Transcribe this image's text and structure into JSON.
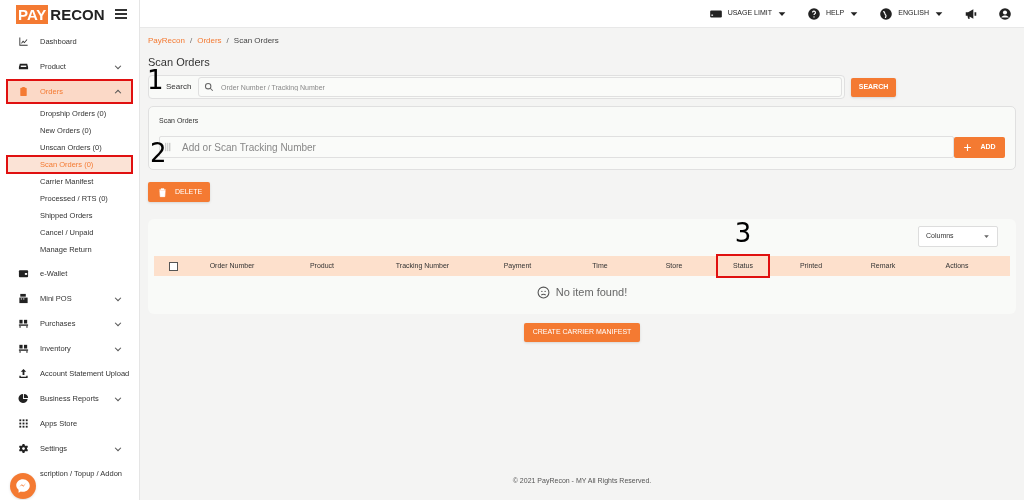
{
  "logo": {
    "left": "PAY",
    "right": "RECON"
  },
  "topbar": [
    {
      "kind": "usage",
      "label": "USAGE LIMIT",
      "dropdown": true
    },
    {
      "kind": "help",
      "label": "HELP",
      "dropdown": true
    },
    {
      "kind": "language",
      "label": "ENGLISH",
      "dropdown": true
    },
    {
      "kind": "announce"
    },
    {
      "kind": "account"
    }
  ],
  "sidebar": {
    "items": [
      {
        "label": "Dashboard",
        "selected": false,
        "highlighted": false
      },
      {
        "label": "Product",
        "selected": false,
        "highlighted": false,
        "expanded": false
      },
      {
        "label": "Orders",
        "selected": true,
        "highlighted": true,
        "expanded": true,
        "children": [
          {
            "label": "Dropship Orders (0)",
            "selected": false,
            "highlighted": false
          },
          {
            "label": "New Orders (0)",
            "selected": false,
            "highlighted": false
          },
          {
            "label": "Unscan Orders (0)",
            "selected": false,
            "highlighted": false
          },
          {
            "label": "Scan Orders (0)",
            "selected": true,
            "highlighted": true
          },
          {
            "label": "Carrier Manifest",
            "selected": false,
            "highlighted": false
          },
          {
            "label": "Processed / RTS (0)",
            "selected": false,
            "highlighted": false
          },
          {
            "label": "Shipped Orders",
            "selected": false,
            "highlighted": false
          },
          {
            "label": "Cancel / Unpaid",
            "selected": false,
            "highlighted": false
          },
          {
            "label": "Manage Return",
            "selected": false,
            "highlighted": false
          }
        ]
      },
      {
        "label": "e-Wallet",
        "selected": false,
        "highlighted": false
      },
      {
        "label": "Mini POS",
        "selected": false,
        "highlighted": false,
        "expanded": false
      },
      {
        "label": "Purchases",
        "selected": false,
        "highlighted": false,
        "expanded": false
      },
      {
        "label": "Inventory",
        "selected": false,
        "highlighted": false,
        "expanded": false
      },
      {
        "label": "Account Statement Upload",
        "selected": false,
        "highlighted": false
      },
      {
        "label": "Business Reports",
        "selected": false,
        "highlighted": false,
        "expanded": false
      },
      {
        "label": "Apps Store",
        "selected": false,
        "highlighted": false
      },
      {
        "label": "Settings",
        "selected": false,
        "highlighted": false,
        "expanded": false
      },
      {
        "label": "scription / Topup / Addon",
        "selected": false,
        "highlighted": false
      }
    ]
  },
  "breadcrumb": {
    "separator": "/",
    "items": [
      {
        "label": "PayRecon",
        "link": true
      },
      {
        "label": "Orders",
        "link": true
      },
      {
        "label": "Scan Orders",
        "link": false
      }
    ]
  },
  "page_title": "Scan Orders",
  "search": {
    "label": "Search",
    "placeholder": "Order Number / Tracking Number",
    "button": "SEARCH",
    "callout": "1"
  },
  "scan": {
    "title": "Scan Orders",
    "placeholder": "Add or Scan Tracking Number",
    "button": "ADD",
    "callout": "2"
  },
  "delete_button": "DELETE",
  "table": {
    "columns_button": "Columns",
    "select_all_checked": false,
    "columns": [
      {
        "label": "Order Number",
        "highlighted": false
      },
      {
        "label": "Product",
        "highlighted": false
      },
      {
        "label": "Tracking Number",
        "highlighted": false
      },
      {
        "label": "Payment",
        "highlighted": false
      },
      {
        "label": "Time",
        "highlighted": false
      },
      {
        "label": "Store",
        "highlighted": false
      },
      {
        "label": "Status",
        "highlighted": true,
        "callout": "3"
      },
      {
        "label": "Printed",
        "highlighted": false
      },
      {
        "label": "Remark",
        "highlighted": false
      },
      {
        "label": "Actions",
        "highlighted": false
      }
    ],
    "empty_message": "No item found!"
  },
  "manifest_button": "CREATE CARRIER MANIFEST",
  "footer": "© 2021 PayRecon - MY All Rights Reserved."
}
